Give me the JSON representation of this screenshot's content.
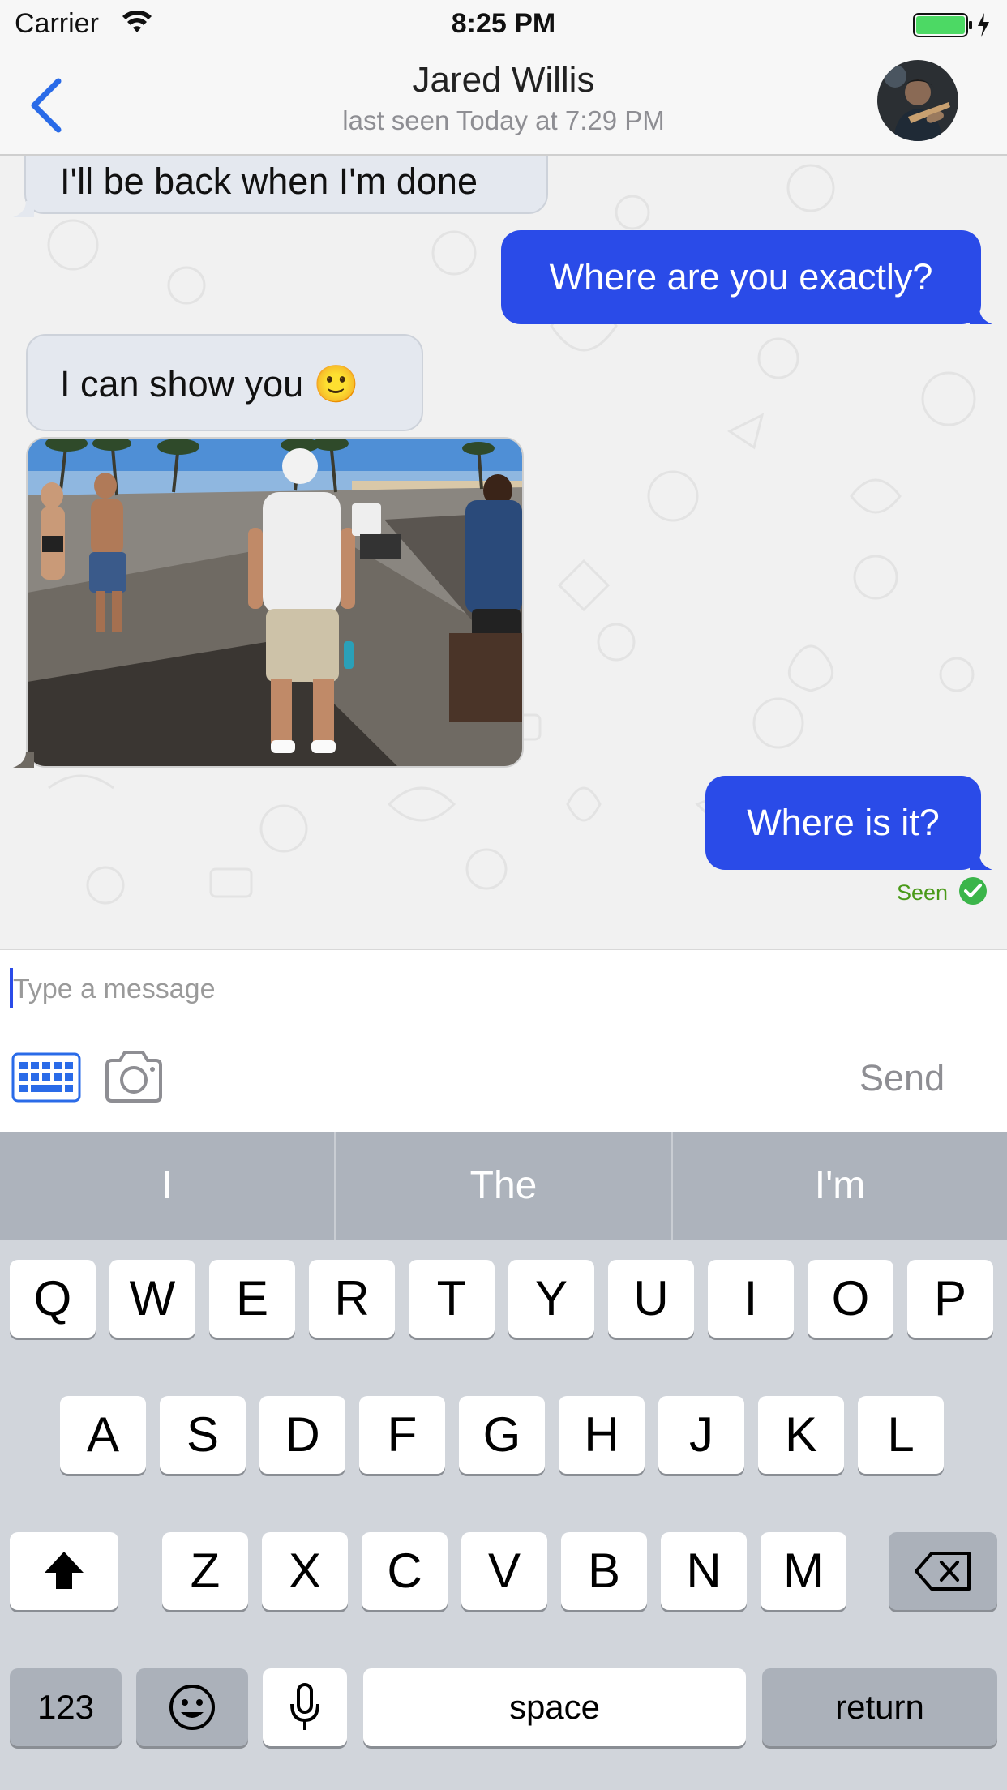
{
  "status_bar": {
    "carrier": "Carrier",
    "time": "8:25 PM",
    "icons": [
      "wifi-icon",
      "battery-icon",
      "charging-bolt-icon"
    ]
  },
  "nav": {
    "back_icon": "chevron-left-icon",
    "contact_name": "Jared Willis",
    "last_seen": "last seen Today at 7:29 PM",
    "avatar": "contact-avatar-photo"
  },
  "messages": [
    {
      "direction": "incoming",
      "type": "text",
      "text": "I'll be back when I'm done"
    },
    {
      "direction": "outgoing",
      "type": "text",
      "text": "Where are you exactly?"
    },
    {
      "direction": "incoming",
      "type": "text",
      "text": "I can show you 🙂"
    },
    {
      "direction": "incoming",
      "type": "image",
      "image": "beach-boardwalk-photo"
    },
    {
      "direction": "outgoing",
      "type": "text",
      "text": "Where is it?",
      "status": "Seen"
    }
  ],
  "input": {
    "placeholder": "Type a message",
    "value": "",
    "keyboard_icon": "keyboard-icon",
    "camera_icon": "camera-icon",
    "send_label": "Send"
  },
  "keyboard": {
    "suggestions": [
      "I",
      "The",
      "I'm"
    ],
    "row1": [
      "Q",
      "W",
      "E",
      "R",
      "T",
      "Y",
      "U",
      "I",
      "O",
      "P"
    ],
    "row2": [
      "A",
      "S",
      "D",
      "F",
      "G",
      "H",
      "J",
      "K",
      "L"
    ],
    "row3": [
      "Z",
      "X",
      "C",
      "V",
      "B",
      "N",
      "M"
    ],
    "numbers_label": "123",
    "space_label": "space",
    "return_label": "return",
    "special_icons": [
      "shift-icon",
      "delete-icon",
      "emoji-icon",
      "microphone-icon"
    ]
  },
  "colors": {
    "outgoing_bubble": "#2a4be8",
    "incoming_bubble": "#e4e8ef",
    "accent": "#2a6be8",
    "seen": "#4a9a19",
    "suggestion_bar": "#adb3bc",
    "keyboard_bg": "#d1d5db"
  }
}
